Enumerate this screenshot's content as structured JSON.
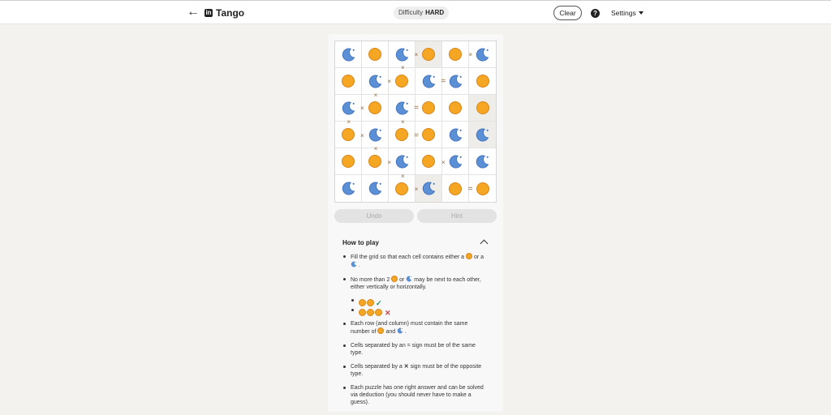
{
  "header": {
    "back_icon": "arrow-left-icon",
    "logo_text": "in",
    "title": "Tango",
    "difficulty_label": "Difficulty",
    "difficulty_value": "HARD",
    "clear_label": "Clear",
    "help_icon": "question-icon",
    "help_glyph": "?",
    "settings_label": "Settings"
  },
  "grid": {
    "size": 6,
    "cells": [
      [
        "moon",
        "sun",
        "moon",
        "sun",
        "sun",
        "moon"
      ],
      [
        "sun",
        "moon",
        "sun",
        "moon",
        "moon",
        "sun"
      ],
      [
        "moon",
        "sun",
        "moon",
        "sun",
        "sun",
        "sun"
      ],
      [
        "sun",
        "moon",
        "sun",
        "sun",
        "moon",
        "moon"
      ],
      [
        "sun",
        "sun",
        "moon",
        "sun",
        "moon",
        "moon"
      ],
      [
        "moon",
        "moon",
        "sun",
        "moon",
        "sun",
        "sun"
      ]
    ],
    "locked": [
      [
        0,
        3
      ],
      [
        2,
        5
      ],
      [
        3,
        5
      ],
      [
        5,
        3
      ]
    ],
    "horizontal_constraints": [
      {
        "row": 0,
        "col": 2,
        "type": "x"
      },
      {
        "row": 0,
        "col": 4,
        "type": "x"
      },
      {
        "row": 1,
        "col": 1,
        "type": "x"
      },
      {
        "row": 1,
        "col": 3,
        "type": "="
      },
      {
        "row": 2,
        "col": 0,
        "type": "x"
      },
      {
        "row": 2,
        "col": 2,
        "type": "="
      },
      {
        "row": 3,
        "col": 0,
        "type": "x"
      },
      {
        "row": 3,
        "col": 2,
        "type": "="
      },
      {
        "row": 4,
        "col": 1,
        "type": "x"
      },
      {
        "row": 4,
        "col": 3,
        "type": "x"
      },
      {
        "row": 5,
        "col": 2,
        "type": "x"
      },
      {
        "row": 5,
        "col": 4,
        "type": "="
      }
    ],
    "vertical_constraints": [
      {
        "row": 0,
        "col": 2,
        "type": "x"
      },
      {
        "row": 1,
        "col": 1,
        "type": "x"
      },
      {
        "row": 2,
        "col": 0,
        "type": "x"
      },
      {
        "row": 2,
        "col": 2,
        "type": "x"
      },
      {
        "row": 3,
        "col": 1,
        "type": "x"
      },
      {
        "row": 4,
        "col": 2,
        "type": "x"
      }
    ],
    "sun_color": "#f5a623",
    "moon_color": "#5b8fd6"
  },
  "actions": {
    "undo_label": "Undo",
    "hint_label": "Hint"
  },
  "how_to_play": {
    "title": "How to play",
    "rule1_a": "Fill the grid so that each cell contains either a",
    "rule1_b": "or a",
    "rule1_c": ".",
    "rule2_a": "No more than 2",
    "rule2_b": "or",
    "rule2_c": "may be next to each other, either vertically or horizontally.",
    "rule3_a": "Each row (and column) must contain the same number of",
    "rule3_b": "and",
    "rule3_c": ".",
    "rule4": "Cells separated by an = sign must be of the same type.",
    "rule5_a": "Cells separated by a",
    "rule5_b": "sign must be of the opposite type.",
    "rule6": "Each puzzle has one right answer and can be solved via deduction (you should never have to make a guess).",
    "ok_glyph": "✓",
    "bad_glyph": "✕",
    "x_glyph": "✕"
  }
}
